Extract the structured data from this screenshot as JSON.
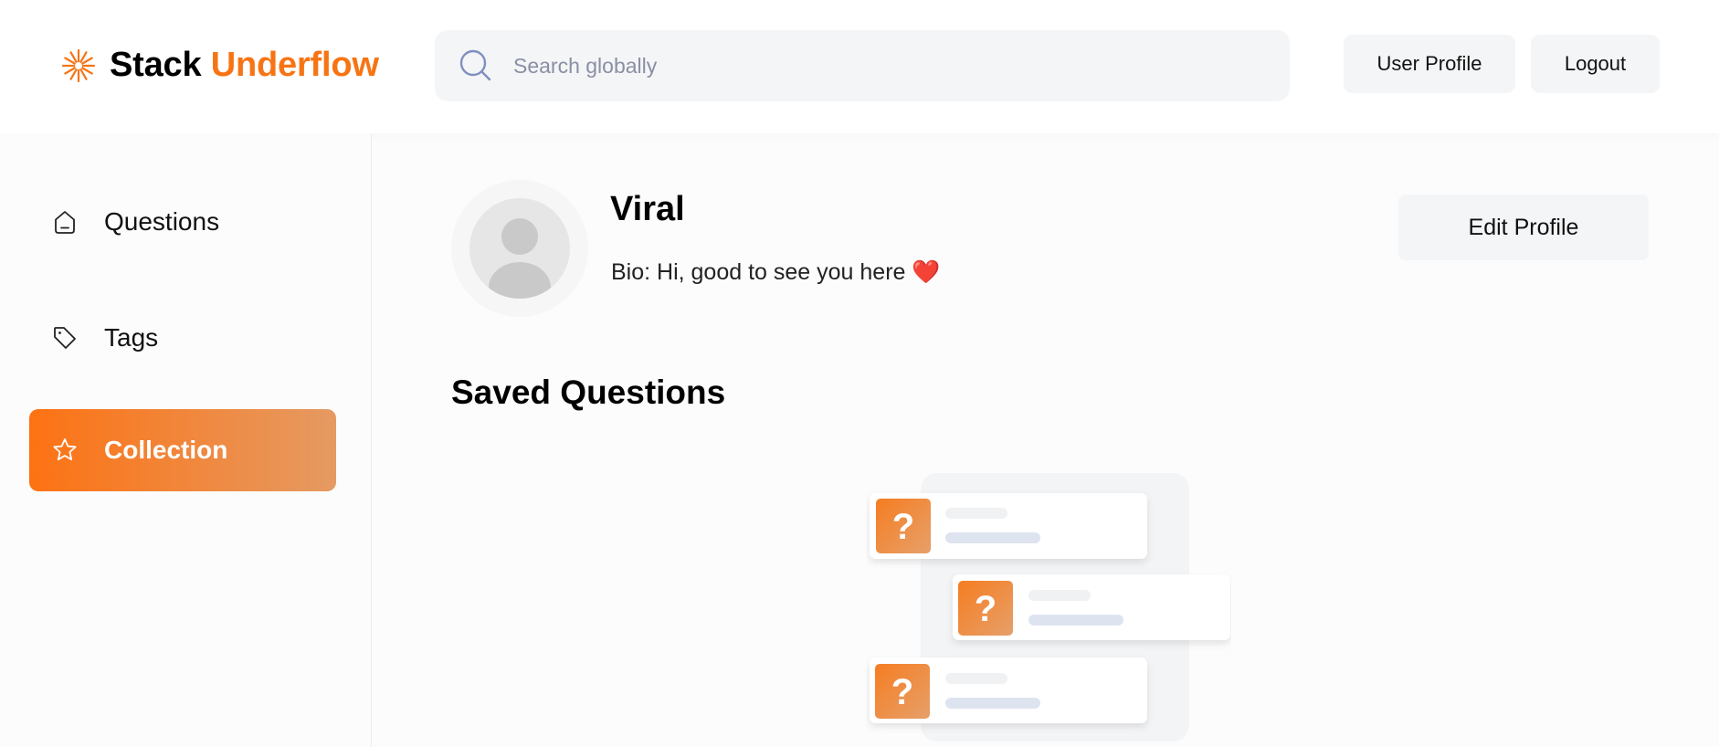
{
  "header": {
    "brand_word1": "Stack",
    "brand_word2": "Underflow",
    "logo_icon": "sunburst-logo-icon",
    "search_icon": "search-icon",
    "search_placeholder": "Search globally",
    "search_value": "",
    "user_profile_label": "User Profile",
    "logout_label": "Logout"
  },
  "sidebar": {
    "items": [
      {
        "label": "Questions",
        "icon": "house-icon",
        "active": false
      },
      {
        "label": "Tags",
        "icon": "tag-icon",
        "active": false
      },
      {
        "label": "Collection",
        "icon": "star-icon",
        "active": true
      }
    ]
  },
  "profile": {
    "name": "Viral",
    "bio": "Bio: Hi, good to see you here",
    "bio_emoji": "❤️",
    "edit_label": "Edit Profile",
    "avatar_icon": "default-avatar-icon"
  },
  "saved": {
    "title": "Saved Questions",
    "placeholder_card_mark": "?"
  },
  "colors": {
    "accent": "#f77414",
    "gradient_start": "#fd7213",
    "gradient_end": "#e59a62",
    "button_bg": "#f4f5f7"
  }
}
